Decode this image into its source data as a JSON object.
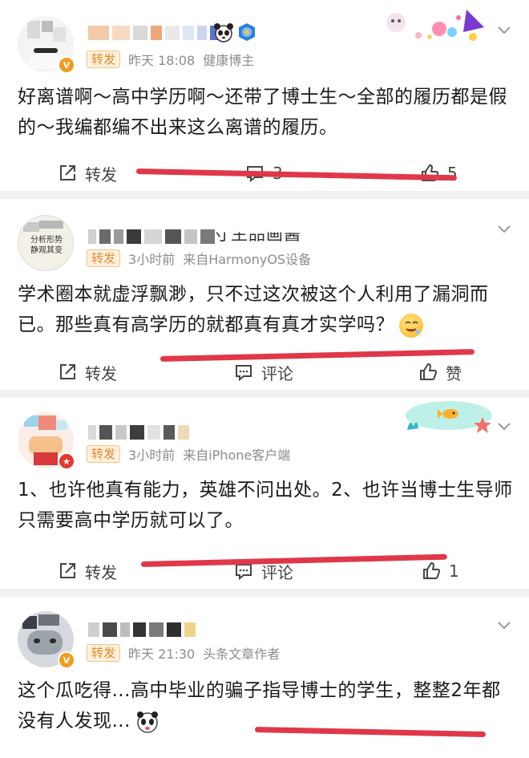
{
  "posts": [
    {
      "time": "昨天 18:08",
      "source": "健康博主",
      "tag": "转发",
      "content": "好离谱啊～高中学历啊～还带了博士生～全部的履历都是假的～我编都编不出来这么离谱的履历。",
      "actions": {
        "repost": "转发",
        "comment": "3",
        "like": "5"
      },
      "verified": "V"
    },
    {
      "name_suffix": "寸主品画酱",
      "time": "3小时前",
      "source": "来自HarmonyOS设备",
      "tag": "转发",
      "content": "学术圈本就虚浮飘渺，只不过这次被这个人利用了漏洞而已。那些真有高学历的就都真有真才实学吗？",
      "actions": {
        "repost": "转发",
        "comment": "评论",
        "like": "赞"
      },
      "avatar_text": [
        "分析形势",
        "静观其变"
      ]
    },
    {
      "time": "3小时前",
      "source": "来自iPhone客户端",
      "tag": "转发",
      "content": "1、也许他真有能力，英雄不问出处。2、也许当博士生导师只需要高中学历就可以了。",
      "actions": {
        "repost": "转发",
        "comment": "评论",
        "like": "1"
      }
    },
    {
      "time": "昨天 21:30",
      "source": "头条文章作者",
      "tag": "转发",
      "content": "这个瓜吃得...高中毕业的骗子指导博士的学生，整整2年都没有人发现...",
      "verified": "V"
    }
  ],
  "colors": {
    "tag_bg": "#fdf0dc",
    "tag_text": "#e08a2b",
    "meta_text": "#8c8c8c",
    "annotation_red": "#e0384a",
    "verified_orange": "#f39a1e",
    "badge_red": "#e23a2e"
  },
  "icons": [
    "repost-icon",
    "comment-icon",
    "like-icon",
    "chevron-down-icon",
    "panda-icon",
    "verified-badge-icon"
  ]
}
